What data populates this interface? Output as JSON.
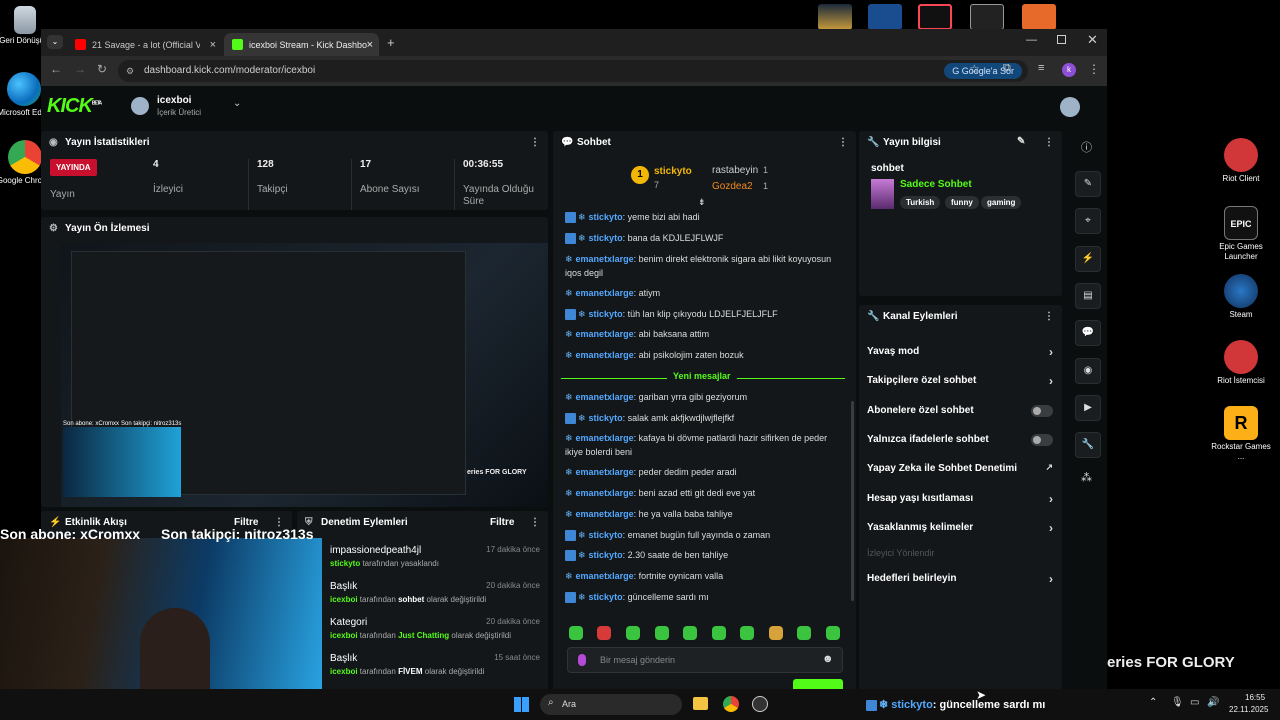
{
  "desktop": {
    "left_icons": [
      {
        "label": "Geri Dönüşü..."
      },
      {
        "label": "Microsoft Edge"
      },
      {
        "label": "Google Chrome"
      }
    ],
    "right_icons": [
      {
        "label": "Riot Client"
      },
      {
        "label": "Epic Games Launcher"
      },
      {
        "label": "Steam"
      },
      {
        "label": "Riot İstemcisi"
      },
      {
        "label": "Rockstar Games ..."
      }
    ]
  },
  "browser": {
    "tabs": [
      {
        "label": "21 Savage - a lot (Official V",
        "color": "#ff0000"
      },
      {
        "label": "icexboi Stream - Kick Dashboar",
        "color": "#53fc18"
      }
    ],
    "url": "dashboard.kick.com/moderator/icexboi",
    "google_btn": "Google'a Sor",
    "profile_letter": "k"
  },
  "kick": {
    "logo": "KICK",
    "beta": "BETA",
    "channel": {
      "name": "icexboi",
      "role": "İçerik Üretici"
    },
    "stats": {
      "title": "Yayın İstatistikleri",
      "live_badge": "YAYINDA",
      "items": [
        {
          "value": "YAYINDA",
          "label": "Yayın"
        },
        {
          "value": "4",
          "label": "İzleyici"
        },
        {
          "value": "128",
          "label": "Takipçi"
        },
        {
          "value": "17",
          "label": "Abone Sayısı"
        },
        {
          "value": "00:36:55",
          "label": "Yayında Olduğu Süre"
        }
      ]
    },
    "preview": {
      "title": "Yayın Ön İzlemesi",
      "caption1": "Son abone: xCromxx",
      "caption2": "Son takipçi: nitroz313s",
      "brand": "eries FOR GLORY"
    },
    "activity": {
      "title": "Etkinlik Akışı",
      "filter": "Filtre",
      "overlay1": "Son abone: xCromxx",
      "overlay2": "Son takipçi: nitroz313s"
    },
    "modlog": {
      "title": "Denetim Eylemleri",
      "filter": "Filtre",
      "rows": [
        {
          "title": "impassionedpeath4jl",
          "time": "17 dakika önce",
          "user": "stickyto",
          "text": " tarafından yasaklandı",
          "extra": ""
        },
        {
          "title": "Başlık",
          "time": "20 dakika önce",
          "user": "icexboi",
          "text": " tarafından ",
          "extra": "sohbet",
          "tail": " olarak değiştirildi"
        },
        {
          "title": "Kategori",
          "time": "20 dakika önce",
          "user": "icexboi",
          "text": " tarafından ",
          "extra": "Just Chatting",
          "tail": " olarak değiştirildi"
        },
        {
          "title": "Başlık",
          "time": "15 saat önce",
          "user": "icexboi",
          "text": " tarafından ",
          "extra": "FİVEM",
          "tail": " olarak değiştirildi"
        }
      ]
    },
    "chat": {
      "title": "Sohbet",
      "leaders": [
        {
          "rank": "1",
          "name": "stickyto",
          "count": "7"
        },
        {
          "name": "rastabeyin",
          "count": "1"
        },
        {
          "name": "Gozdea2",
          "count": "1"
        }
      ],
      "messages": [
        {
          "user": "stickyto",
          "text": ": yeme bizi abi hadi",
          "badge": true
        },
        {
          "user": "stickyto",
          "text": ": bana da KDJLEJFLWJF",
          "badge": true
        },
        {
          "user": "emanetxlarge",
          "text": ": benim direkt elektronik sigara abi likit koyuyosun iqos degil",
          "badge": false
        },
        {
          "user": "emanetxlarge",
          "text": ": atiym",
          "badge": false
        },
        {
          "user": "stickyto",
          "text": ": tüh lan klip çıkıyodu LDJELFJELJFLF",
          "badge": true
        },
        {
          "user": "emanetxlarge",
          "text": ": abi baksana attim",
          "badge": false
        },
        {
          "user": "emanetxlarge",
          "text": ": abi psikolojim zaten bozuk",
          "badge": false
        }
      ],
      "new_messages": "Yeni mesajlar",
      "messages2": [
        {
          "user": "emanetxlarge",
          "text": ": gariban yrra gibi geziyorum",
          "badge": false
        },
        {
          "user": "stickyto",
          "text": ": salak amk akfjkwdjlwjflejfkf",
          "badge": true
        },
        {
          "user": "emanetxlarge",
          "text": ": kafaya bi dövme patlardi hazir sifirken de peder ikiye bolerdi beni",
          "badge": false
        },
        {
          "user": "emanetxlarge",
          "text": ": peder dedim peder aradi",
          "badge": false
        },
        {
          "user": "emanetxlarge",
          "text": ": beni azad etti git dedi eve yat",
          "badge": false
        },
        {
          "user": "emanetxlarge",
          "text": ": he ya valla baba tahliye",
          "badge": false
        },
        {
          "user": "stickyto",
          "text": ": emanet bugün full yayında o zaman",
          "badge": true
        },
        {
          "user": "stickyto",
          "text": ": 2.30 saate de ben tahliye",
          "badge": true
        },
        {
          "user": "emanetxlarge",
          "text": ": fortnite oynicam valla",
          "badge": false
        },
        {
          "user": "stickyto",
          "text": ": güncelleme sardı mı",
          "badge": true
        }
      ],
      "placeholder": "Bir mesaj gönderin"
    },
    "info": {
      "title": "Yayın bilgisi",
      "stream_title": "sohbet",
      "category": "Sadece Sohbet",
      "tags": [
        "Turkish",
        "funny",
        "gaming"
      ]
    },
    "channel_actions": {
      "title": "Kanal Eylemleri",
      "items": [
        {
          "label": "Yavaş mod",
          "type": "arrow"
        },
        {
          "label": "Takipçilere özel sohbet",
          "type": "arrow"
        },
        {
          "label": "Abonelere özel sohbet",
          "type": "toggle"
        },
        {
          "label": "Yalnızca ifadelerle sohbet",
          "type": "toggle"
        },
        {
          "label": "Yapay Zeka ile Sohbet Denetimi",
          "type": "ext"
        },
        {
          "label": "Hesap yaşı kısıtlaması",
          "type": "arrow"
        },
        {
          "label": "Yasaklanmış kelimeler",
          "type": "arrow"
        },
        {
          "label": "İzleyici Yönlendir",
          "type": "disabled"
        },
        {
          "label": "Hedefleri belirleyin",
          "type": "arrow"
        }
      ]
    }
  },
  "overlay": {
    "bottom_chat_user": "stickyto",
    "bottom_chat_text": ": güncelleme sardı mı",
    "brand": "eries FOR GLORY",
    "cam_mark": "6"
  },
  "taskbar": {
    "search": "Ara",
    "time": "16:55",
    "date": "22.11.2025"
  }
}
